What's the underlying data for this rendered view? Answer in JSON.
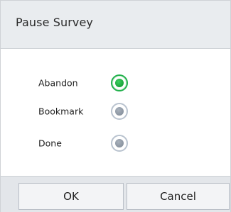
{
  "dialog": {
    "title": "Pause Survey",
    "options": [
      {
        "label": "Abandon",
        "selected": true
      },
      {
        "label": "Bookmark",
        "selected": false
      },
      {
        "label": "Done",
        "selected": false
      }
    ],
    "buttons": {
      "ok_label": "OK",
      "cancel_label": "Cancel"
    }
  },
  "colors": {
    "selected_radio": "#22b14c",
    "unselected_radio": "#8a94a0",
    "header_bg": "#e9ecef",
    "footer_bg": "#e3e6ea"
  }
}
